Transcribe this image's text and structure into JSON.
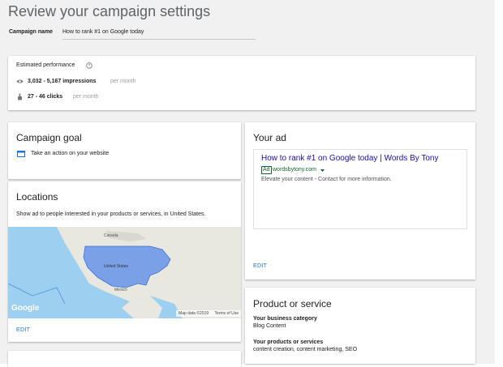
{
  "page": {
    "title": "Review your campaign settings",
    "campaign_name_label": "Campaign name",
    "campaign_name_value": "How to rank #1 on Google today"
  },
  "performance": {
    "label": "Estimated performance",
    "impressions_value": "3,032 - 5,167 impressions",
    "impressions_unit": "per month",
    "clicks_value": "27 - 46 clicks",
    "clicks_unit": "per month"
  },
  "goal": {
    "title": "Campaign goal",
    "value": "Take an action on your website"
  },
  "locations": {
    "title": "Locations",
    "description": "Show ad to people interested in your products or services, in United States.",
    "edit_label": "EDIT",
    "map": {
      "label_canada": "Canada",
      "label_us": "United States",
      "label_mexico": "Mexico",
      "logo": "Google",
      "attribution": "Map data ©2019",
      "terms": "Terms of Use"
    }
  },
  "ad": {
    "title": "Your ad",
    "headline": "How to rank #1 on Google today | Words By Tony",
    "badge": "Ad",
    "url": "wordsbytony.com",
    "description": "Elevate your content - Contact for more information.",
    "edit_label": "EDIT"
  },
  "product": {
    "title": "Product or service",
    "category_label": "Your business category",
    "category_value": "Blog Content",
    "products_label": "Your products or services",
    "products_value": "content creation, content marketing, SEO"
  },
  "colors": {
    "accent": "#1a73e8",
    "ad_green": "#0d652d",
    "ad_headline": "#1a0dab",
    "map_water": "#9dd0f0",
    "map_land": "#e8e8e1",
    "map_highlight": "#7aa0e8"
  }
}
